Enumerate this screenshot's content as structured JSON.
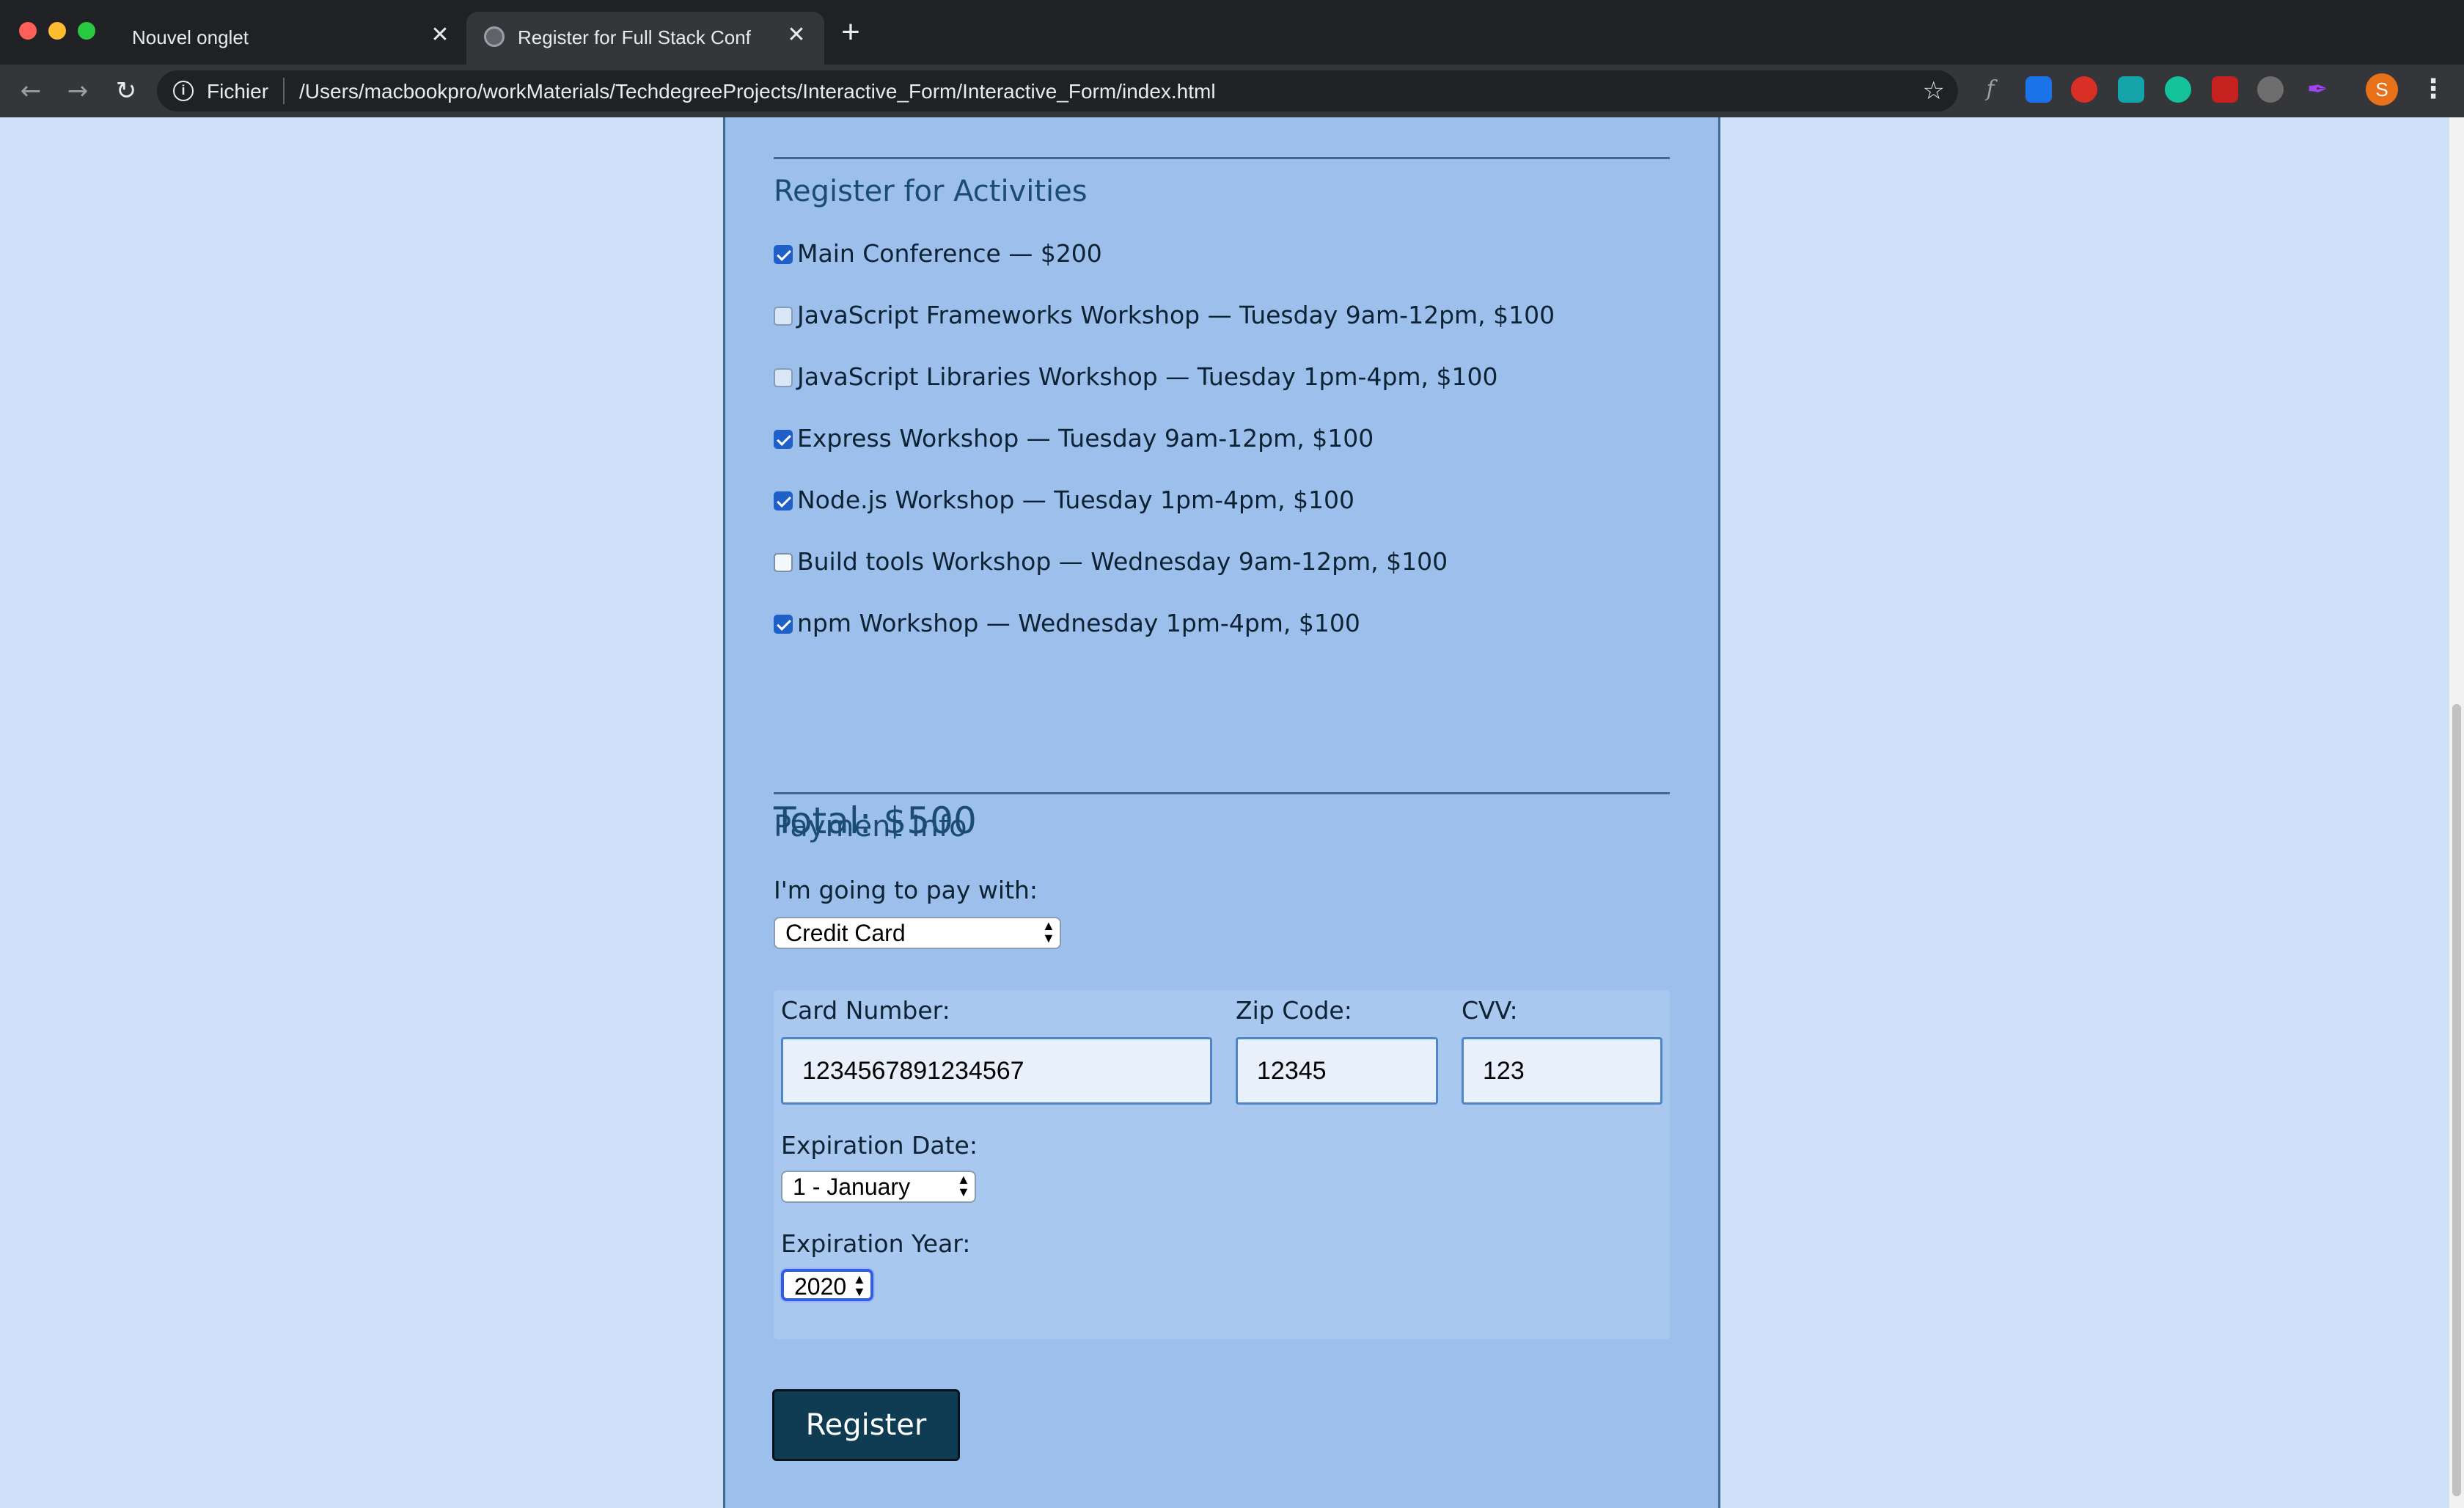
{
  "browser": {
    "tabs": [
      {
        "label": "Nouvel onglet",
        "active": false
      },
      {
        "label": "Register for Full Stack Conf",
        "active": true
      }
    ],
    "new_tab_symbol": "+",
    "close_symbol": "✕",
    "omnibox": {
      "scheme_label": "Fichier",
      "url": "/Users/macbookpro/workMaterials/TechdegreeProjects/Interactive_Form/Interactive_Form/index.html"
    },
    "profile_initial": "S",
    "extension_icons": [
      "function-icon",
      "extension-blue-icon",
      "adblock-icon",
      "image-extension-icon",
      "grammarly-icon",
      "extension-red-icon",
      "pinterest-icon",
      "pen-icon"
    ]
  },
  "activities": {
    "legend": "Register for Activities",
    "items": [
      {
        "label": "Main Conference — $200",
        "checked": true
      },
      {
        "label": "JavaScript Frameworks Workshop — Tuesday 9am-12pm, $100",
        "checked": false
      },
      {
        "label": "JavaScript Libraries Workshop — Tuesday 1pm-4pm, $100",
        "checked": false
      },
      {
        "label": "Express Workshop — Tuesday 9am-12pm, $100",
        "checked": true
      },
      {
        "label": "Node.js Workshop — Tuesday 1pm-4pm, $100",
        "checked": true
      },
      {
        "label": "Build tools Workshop — Wednesday 9am-12pm, $100",
        "checked": false
      },
      {
        "label": "npm Workshop — Wednesday 1pm-4pm, $100",
        "checked": true
      }
    ],
    "total": "Total: $500"
  },
  "payment": {
    "legend": "Payment Info",
    "method_label": "I'm going to pay with:",
    "method_value": "Credit Card",
    "card_number_label": "Card Number:",
    "card_number_value": "1234567891234567",
    "zip_label": "Zip Code:",
    "zip_value": "12345",
    "cvv_label": "CVV:",
    "cvv_value": "123",
    "exp_date_label": "Expiration Date:",
    "exp_date_value": "1 - January",
    "exp_year_label": "Expiration Year:",
    "exp_year_value": "2020"
  },
  "register_label": "Register",
  "colors": {
    "page_background": "#cfe1f9",
    "panel_background": "#9cbfec",
    "heading": "#1b4d73",
    "button": "#0f3c52",
    "checkbox_checked": "#1f5fc8"
  }
}
